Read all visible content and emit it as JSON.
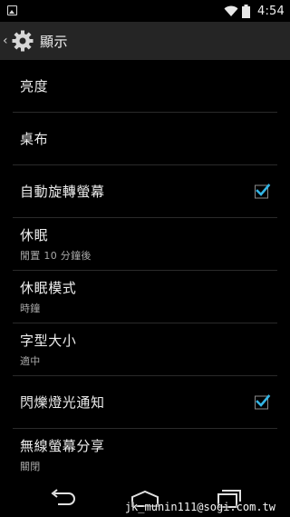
{
  "status_bar": {
    "time": "4:54",
    "icons": [
      "image-notification-icon",
      "wifi-icon",
      "battery-icon"
    ]
  },
  "action_bar": {
    "up_glyph": "‹",
    "title": "顯示"
  },
  "settings": [
    {
      "title": "亮度",
      "summary": "",
      "checked": null
    },
    {
      "title": "桌布",
      "summary": "",
      "checked": null
    },
    {
      "title": "自動旋轉螢幕",
      "summary": "",
      "checked": true
    },
    {
      "title": "休眠",
      "summary": "閒置 10 分鐘後",
      "checked": null
    },
    {
      "title": "休眠模式",
      "summary": "時鐘",
      "checked": null
    },
    {
      "title": "字型大小",
      "summary": "適中",
      "checked": null
    },
    {
      "title": "閃爍燈光通知",
      "summary": "",
      "checked": true
    },
    {
      "title": "無線螢幕分享",
      "summary": "關閉",
      "checked": null
    }
  ],
  "nav_bar": {
    "buttons": [
      "back-button",
      "home-button",
      "recents-button"
    ]
  },
  "watermark": "jk_munin111@sogi.com.tw",
  "colors": {
    "accent": "#33b5e5",
    "action_bar_bg": "#252525",
    "background": "#000000"
  }
}
